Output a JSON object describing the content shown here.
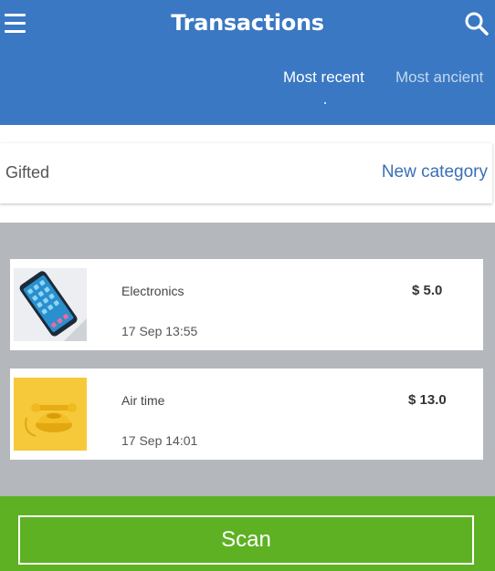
{
  "header": {
    "title": "Transactions",
    "menu_icon": "hamburger-menu-icon",
    "search_icon": "search-icon",
    "tabs": [
      {
        "label": "Most recent",
        "active": true
      },
      {
        "label": "Most ancient",
        "active": false
      }
    ],
    "color": "#3a78c3"
  },
  "category": {
    "label": "Gifted",
    "new_label": "New category"
  },
  "transactions": [
    {
      "name": "Electronics",
      "amount": "$ 5.0",
      "date": "17 Sep 13:55",
      "icon": "smartphone-photo"
    },
    {
      "name": "Air time",
      "amount": "$ 13.0",
      "date": "17 Sep 14:01",
      "icon": "telephone-photo"
    }
  ],
  "footer": {
    "scan_label": "Scan",
    "color": "#5eb123"
  }
}
